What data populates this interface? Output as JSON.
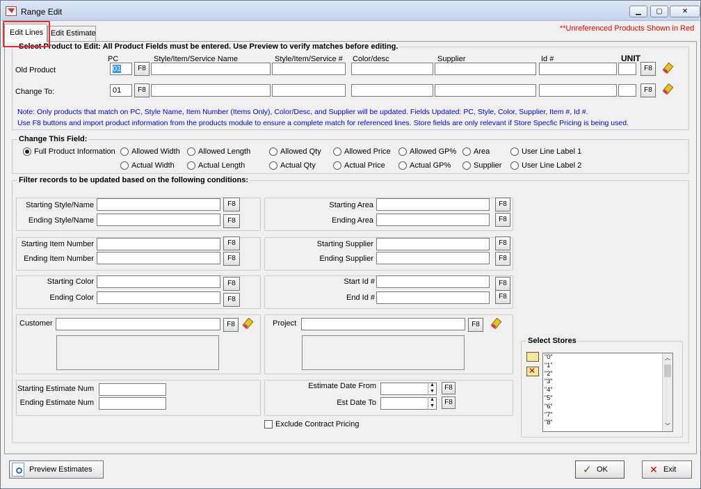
{
  "window": {
    "title": "Range Edit",
    "minimize": "▁",
    "maximize": "▢",
    "close": "✕"
  },
  "tabs": [
    {
      "label": "Edit Lines",
      "active": true
    },
    {
      "label": "Edit Estimate",
      "active": false
    }
  ],
  "notice": "**Unreferenced Products Shown in Red",
  "select_product": {
    "heading": "Select Product to Edit:  All Product Fields must be entered.  Use Preview to verify matches before editing.",
    "columns": {
      "pc": "PC",
      "style": "Style/Item/Service Name",
      "style_num": "Style/Item/Service #",
      "color": "Color/desc",
      "supplier": "Supplier",
      "id": "Id #",
      "unit": "UNIT"
    },
    "old_product": {
      "label": "Old Product",
      "pc": "01"
    },
    "change_to": {
      "label": "Change To:",
      "pc": "01"
    },
    "f8": "F8",
    "note1": "Note: Only products that match on PC, Style Name, Item Number (Items Only), Color/Desc, and Supplier will be updated.  Fields Updated:  PC, Style, Color, Supplier, Item #, Id #.",
    "note2": "Use F8 buttons and import product information from the products module to ensure a complete match for referenced lines.  Store fields are only relevant if Store Specfic Pricing is being used."
  },
  "change_field": {
    "heading": "Change This Field:",
    "options": [
      {
        "label": "Full Product Information",
        "selected": true
      },
      {
        "label": "Allowed Width",
        "selected": false
      },
      {
        "label": "Allowed Length",
        "selected": false
      },
      {
        "label": "Allowed Qty",
        "selected": false
      },
      {
        "label": "Allowed Price",
        "selected": false
      },
      {
        "label": "Allowed GP%",
        "selected": false
      },
      {
        "label": "Area",
        "selected": false
      },
      {
        "label": "User Line Label 1",
        "selected": false
      },
      {
        "label": "Actual Width",
        "selected": false
      },
      {
        "label": "Actual Length",
        "selected": false
      },
      {
        "label": "Actual Qty",
        "selected": false
      },
      {
        "label": "Actual Price",
        "selected": false
      },
      {
        "label": "Actual GP%",
        "selected": false
      },
      {
        "label": "Supplier",
        "selected": false
      },
      {
        "label": "User Line Label 2",
        "selected": false
      }
    ]
  },
  "filter": {
    "heading": "Filter records to be updated based on the following conditions:",
    "starting_style": "Starting Style/Name",
    "ending_style": "Ending Style/Name",
    "starting_item": "Starting Item Number",
    "ending_item": "Ending Item Number",
    "starting_color": "Starting Color",
    "ending_color": "Ending Color",
    "starting_area": "Starting Area",
    "ending_area": "Ending Area",
    "starting_supplier": "Starting Supplier",
    "ending_supplier": "Ending Supplier",
    "start_id": "Start Id #",
    "end_id": "End Id #",
    "customer": "Customer",
    "project": "Project",
    "starting_estimate": "Starting Estimate Num",
    "ending_estimate": "Ending Estimate Num",
    "estimate_date_from": "Estimate Date From",
    "est_date_to": "Est Date To",
    "exclude_contract": "Exclude Contract Pricing"
  },
  "stores": {
    "heading": "Select Stores",
    "items": [
      "\"0\"",
      "\"1\"",
      "\"2\"",
      "\"3\"",
      "\"4\"",
      "\"5\"",
      "\"6\"",
      "\"7\"",
      "\"8\""
    ]
  },
  "footer": {
    "preview": "Preview Estimates",
    "ok": "OK",
    "exit": "Exit"
  }
}
